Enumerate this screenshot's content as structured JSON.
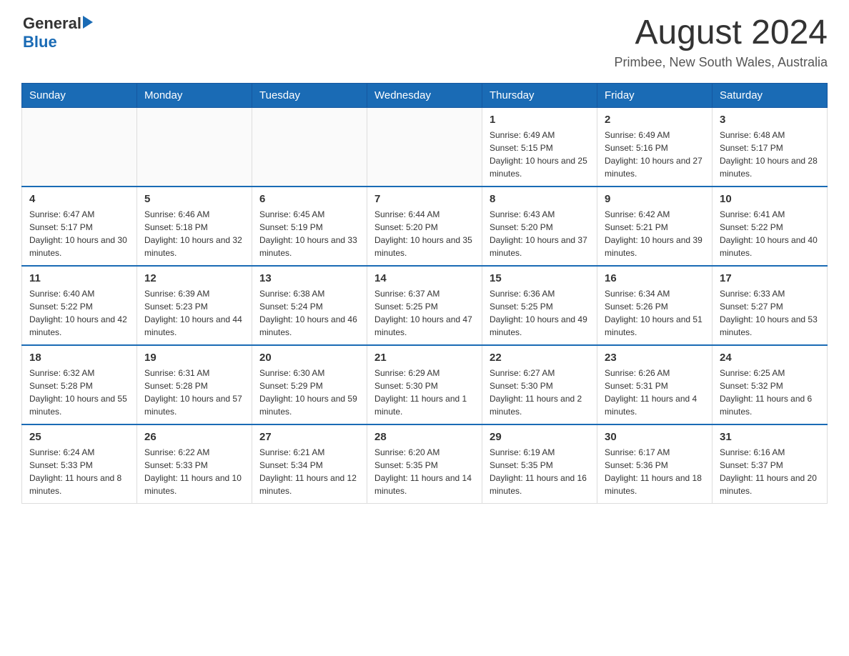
{
  "logo": {
    "text_general": "General",
    "text_blue": "Blue"
  },
  "title": "August 2024",
  "subtitle": "Primbee, New South Wales, Australia",
  "days_of_week": [
    "Sunday",
    "Monday",
    "Tuesday",
    "Wednesday",
    "Thursday",
    "Friday",
    "Saturday"
  ],
  "weeks": [
    [
      {
        "day": "",
        "info": ""
      },
      {
        "day": "",
        "info": ""
      },
      {
        "day": "",
        "info": ""
      },
      {
        "day": "",
        "info": ""
      },
      {
        "day": "1",
        "info": "Sunrise: 6:49 AM\nSunset: 5:15 PM\nDaylight: 10 hours and 25 minutes."
      },
      {
        "day": "2",
        "info": "Sunrise: 6:49 AM\nSunset: 5:16 PM\nDaylight: 10 hours and 27 minutes."
      },
      {
        "day": "3",
        "info": "Sunrise: 6:48 AM\nSunset: 5:17 PM\nDaylight: 10 hours and 28 minutes."
      }
    ],
    [
      {
        "day": "4",
        "info": "Sunrise: 6:47 AM\nSunset: 5:17 PM\nDaylight: 10 hours and 30 minutes."
      },
      {
        "day": "5",
        "info": "Sunrise: 6:46 AM\nSunset: 5:18 PM\nDaylight: 10 hours and 32 minutes."
      },
      {
        "day": "6",
        "info": "Sunrise: 6:45 AM\nSunset: 5:19 PM\nDaylight: 10 hours and 33 minutes."
      },
      {
        "day": "7",
        "info": "Sunrise: 6:44 AM\nSunset: 5:20 PM\nDaylight: 10 hours and 35 minutes."
      },
      {
        "day": "8",
        "info": "Sunrise: 6:43 AM\nSunset: 5:20 PM\nDaylight: 10 hours and 37 minutes."
      },
      {
        "day": "9",
        "info": "Sunrise: 6:42 AM\nSunset: 5:21 PM\nDaylight: 10 hours and 39 minutes."
      },
      {
        "day": "10",
        "info": "Sunrise: 6:41 AM\nSunset: 5:22 PM\nDaylight: 10 hours and 40 minutes."
      }
    ],
    [
      {
        "day": "11",
        "info": "Sunrise: 6:40 AM\nSunset: 5:22 PM\nDaylight: 10 hours and 42 minutes."
      },
      {
        "day": "12",
        "info": "Sunrise: 6:39 AM\nSunset: 5:23 PM\nDaylight: 10 hours and 44 minutes."
      },
      {
        "day": "13",
        "info": "Sunrise: 6:38 AM\nSunset: 5:24 PM\nDaylight: 10 hours and 46 minutes."
      },
      {
        "day": "14",
        "info": "Sunrise: 6:37 AM\nSunset: 5:25 PM\nDaylight: 10 hours and 47 minutes."
      },
      {
        "day": "15",
        "info": "Sunrise: 6:36 AM\nSunset: 5:25 PM\nDaylight: 10 hours and 49 minutes."
      },
      {
        "day": "16",
        "info": "Sunrise: 6:34 AM\nSunset: 5:26 PM\nDaylight: 10 hours and 51 minutes."
      },
      {
        "day": "17",
        "info": "Sunrise: 6:33 AM\nSunset: 5:27 PM\nDaylight: 10 hours and 53 minutes."
      }
    ],
    [
      {
        "day": "18",
        "info": "Sunrise: 6:32 AM\nSunset: 5:28 PM\nDaylight: 10 hours and 55 minutes."
      },
      {
        "day": "19",
        "info": "Sunrise: 6:31 AM\nSunset: 5:28 PM\nDaylight: 10 hours and 57 minutes."
      },
      {
        "day": "20",
        "info": "Sunrise: 6:30 AM\nSunset: 5:29 PM\nDaylight: 10 hours and 59 minutes."
      },
      {
        "day": "21",
        "info": "Sunrise: 6:29 AM\nSunset: 5:30 PM\nDaylight: 11 hours and 1 minute."
      },
      {
        "day": "22",
        "info": "Sunrise: 6:27 AM\nSunset: 5:30 PM\nDaylight: 11 hours and 2 minutes."
      },
      {
        "day": "23",
        "info": "Sunrise: 6:26 AM\nSunset: 5:31 PM\nDaylight: 11 hours and 4 minutes."
      },
      {
        "day": "24",
        "info": "Sunrise: 6:25 AM\nSunset: 5:32 PM\nDaylight: 11 hours and 6 minutes."
      }
    ],
    [
      {
        "day": "25",
        "info": "Sunrise: 6:24 AM\nSunset: 5:33 PM\nDaylight: 11 hours and 8 minutes."
      },
      {
        "day": "26",
        "info": "Sunrise: 6:22 AM\nSunset: 5:33 PM\nDaylight: 11 hours and 10 minutes."
      },
      {
        "day": "27",
        "info": "Sunrise: 6:21 AM\nSunset: 5:34 PM\nDaylight: 11 hours and 12 minutes."
      },
      {
        "day": "28",
        "info": "Sunrise: 6:20 AM\nSunset: 5:35 PM\nDaylight: 11 hours and 14 minutes."
      },
      {
        "day": "29",
        "info": "Sunrise: 6:19 AM\nSunset: 5:35 PM\nDaylight: 11 hours and 16 minutes."
      },
      {
        "day": "30",
        "info": "Sunrise: 6:17 AM\nSunset: 5:36 PM\nDaylight: 11 hours and 18 minutes."
      },
      {
        "day": "31",
        "info": "Sunrise: 6:16 AM\nSunset: 5:37 PM\nDaylight: 11 hours and 20 minutes."
      }
    ]
  ]
}
